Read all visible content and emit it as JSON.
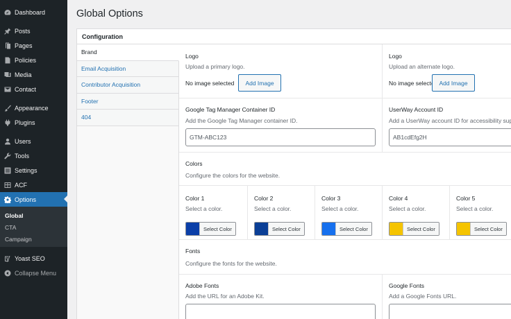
{
  "sidebar": {
    "items": [
      {
        "label": "Dashboard",
        "icon": "dashboard-icon"
      },
      {
        "label": "Posts",
        "icon": "pin-icon"
      },
      {
        "label": "Pages",
        "icon": "pages-icon"
      },
      {
        "label": "Policies",
        "icon": "document-icon"
      },
      {
        "label": "Media",
        "icon": "media-icon"
      },
      {
        "label": "Contact",
        "icon": "envelope-icon"
      },
      {
        "label": "Appearance",
        "icon": "paintbrush-icon"
      },
      {
        "label": "Plugins",
        "icon": "plugin-icon"
      },
      {
        "label": "Users",
        "icon": "users-icon"
      },
      {
        "label": "Tools",
        "icon": "wrench-icon"
      },
      {
        "label": "Settings",
        "icon": "settings-icon"
      },
      {
        "label": "ACF",
        "icon": "acf-icon"
      },
      {
        "label": "Options",
        "icon": "gear-icon"
      }
    ],
    "submenu": [
      "Global",
      "CTA",
      "Campaign"
    ],
    "yoast": "Yoast SEO",
    "collapse": "Collapse Menu"
  },
  "page": {
    "title": "Global Options",
    "panel_title": "Configuration"
  },
  "tabs": [
    "Brand",
    "Email Acquisition",
    "Contributor Acquisition",
    "Footer",
    "404"
  ],
  "fields": {
    "logo": {
      "label": "Logo",
      "desc": "Upload a primary logo.",
      "no_image": "No image selected",
      "button": "Add Image"
    },
    "alt_logo": {
      "label": "Logo",
      "desc": "Upload an alternate logo.",
      "no_image": "No image selected",
      "button": "Add Image"
    },
    "gtm": {
      "label": "Google Tag Manager Container ID",
      "desc": "Add the Google Tag Manager container ID.",
      "value": "GTM-ABC123"
    },
    "userway": {
      "label": "UserWay Account ID",
      "desc": "Add a UserWay account ID for accessibility sup",
      "value": "AB1cdEfg2H"
    },
    "colors": {
      "label": "Colors",
      "desc": "Configure the colors for the website."
    },
    "color_items": [
      {
        "label": "Color 1",
        "desc": "Select a color.",
        "button": "Select Color",
        "color": "#0b3fa8"
      },
      {
        "label": "Color 2",
        "desc": "Select a color.",
        "button": "Select Color",
        "color": "#0b3f96"
      },
      {
        "label": "Color 3",
        "desc": "Select a color.",
        "button": "Select Color",
        "color": "#1670ee"
      },
      {
        "label": "Color 4",
        "desc": "Select a color.",
        "button": "Select Color",
        "color": "#f5c400"
      },
      {
        "label": "Color 5",
        "desc": "Select a color.",
        "button": "Select Color",
        "color": "#f5c400"
      }
    ],
    "fonts": {
      "label": "Fonts",
      "desc": "Configure the fonts for the website."
    },
    "adobe": {
      "label": "Adobe Fonts",
      "desc": "Add the URL for an Adobe Kit."
    },
    "google": {
      "label": "Google Fonts",
      "desc": "Add a Google Fonts URL."
    }
  },
  "colors": {
    "accent": "#2271b1",
    "sidebar_bg": "#1d2327"
  }
}
